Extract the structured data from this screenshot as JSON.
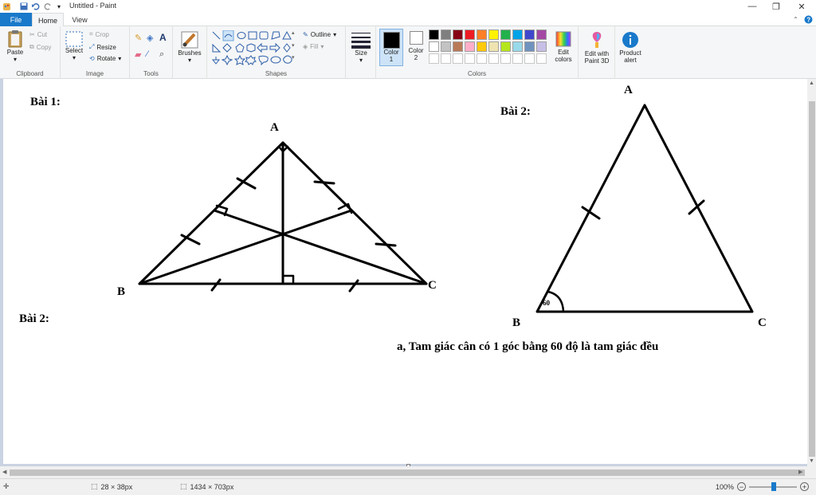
{
  "window": {
    "title": "Untitled - Paint"
  },
  "tabs": {
    "file": "File",
    "home": "Home",
    "view": "View"
  },
  "clipboard": {
    "paste": "Paste",
    "cut": "Cut",
    "copy": "Copy",
    "label": "Clipboard"
  },
  "image": {
    "select": "Select",
    "crop": "Crop",
    "resize": "Resize",
    "rotate": "Rotate",
    "label": "Image"
  },
  "tools": {
    "label": "Tools"
  },
  "brushes": {
    "label": "Brushes"
  },
  "shapes": {
    "outline": "Outline",
    "fill": "Fill",
    "label": "Shapes"
  },
  "size": {
    "label": "Size"
  },
  "colors": {
    "color1_line1": "Color",
    "color1_line2": "1",
    "color2_line1": "Color",
    "color2_line2": "2",
    "edit_line1": "Edit",
    "edit_line2": "colors",
    "label": "Colors",
    "color1_value": "#000000",
    "color2_value": "#ffffff",
    "palette": [
      "#000000",
      "#7f7f7f",
      "#880015",
      "#ed1c24",
      "#ff7f27",
      "#fff200",
      "#22b14c",
      "#00a2e8",
      "#3f48cc",
      "#a349a4",
      "#ffffff",
      "#c3c3c3",
      "#b97a57",
      "#ffaec9",
      "#ffc90e",
      "#efe4b0",
      "#b5e61d",
      "#99d9ea",
      "#7092be",
      "#c8bfe7",
      "#ffffff",
      "#ffffff",
      "#ffffff",
      "#ffffff",
      "#ffffff",
      "#ffffff",
      "#ffffff",
      "#ffffff",
      "#ffffff",
      "#ffffff"
    ]
  },
  "paint3d": {
    "line1": "Edit with",
    "line2": "Paint 3D"
  },
  "product_alert": {
    "line1": "Product",
    "line2": "alert"
  },
  "drawing": {
    "bai1": "Bài 1:",
    "bai2_left": "Bài 2:",
    "bai2_right": "Bài 2:",
    "fig1": {
      "A": "A",
      "B": "B",
      "C": "C"
    },
    "fig2": {
      "A": "A",
      "B": "B",
      "C": "C",
      "angle": "60"
    },
    "statement": "a, Tam giác cân có 1 góc bằng 60 độ là tam giác đều"
  },
  "status": {
    "selection": "28 × 38px",
    "canvas_size": "1434 × 703px",
    "zoom": "100%"
  }
}
